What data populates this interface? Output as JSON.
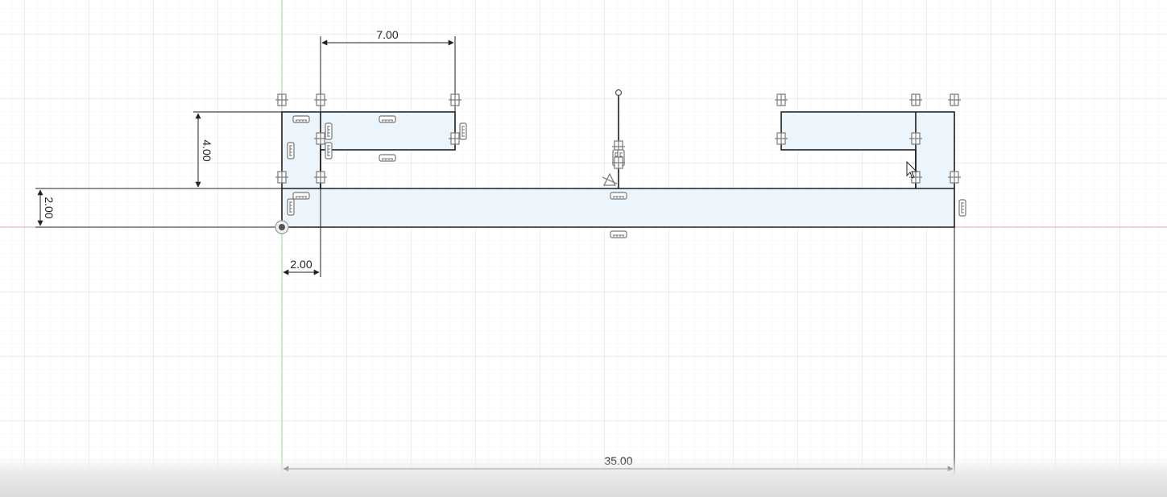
{
  "colors": {
    "grid_minor": "#f1f1f1",
    "grid_major": "#dcdcdc",
    "axis_x": "#e6a7ad",
    "axis_y": "#9ad39a",
    "profile_fill": "#ecf4fc",
    "sketch_line": "#1e1e1e",
    "construction_line": "#66b7dc",
    "constraint_icon": "#777777"
  },
  "dimensions": {
    "top_width": "7.00",
    "left_height": "4.00",
    "base_height": "2.00",
    "left_width": "2.00",
    "total_length": "35.00"
  },
  "icons": {
    "constraint_coincident": "coincident-constraint-icon",
    "constraint_horizontal": "horizontal-constraint-icon",
    "constraint_vertical": "vertical-constraint-icon",
    "constraint_midpoint": "midpoint-constraint-icon",
    "origin": "origin-point-icon",
    "cursor": "mouse-pointer-icon"
  }
}
